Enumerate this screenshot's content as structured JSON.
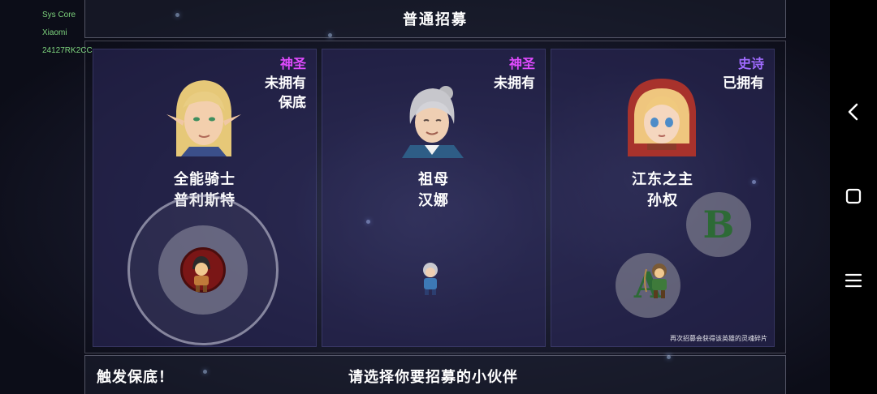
{
  "device_overlay": {
    "line1": "Sys Core",
    "line2": "Xiaomi",
    "line3": "24127RK2CC"
  },
  "header": {
    "title": "普通招募"
  },
  "cards": [
    {
      "rarity": "神圣",
      "owned_status": "未拥有",
      "pity_label": "保底",
      "hero_title": "全能骑士",
      "hero_name": "普利斯特",
      "portrait_icon": "elf-knight-portrait"
    },
    {
      "rarity": "神圣",
      "owned_status": "未拥有",
      "hero_title": "祖母",
      "hero_name": "汉娜",
      "portrait_icon": "grandmother-portrait"
    },
    {
      "rarity": "史诗",
      "owned_status": "已拥有",
      "hero_title": "江东之主",
      "hero_name": "孙权",
      "portrait_icon": "red-hood-girl-portrait",
      "note": "再次招募会获得该英雄的灵魂碎片"
    }
  ],
  "controls": {
    "b_label": "B",
    "a_label": "A"
  },
  "footer": {
    "trigger_text": "触发保底！",
    "prompt_text": "请选择你要招募的小伙伴"
  },
  "colors": {
    "divine": "#e14bff",
    "epic": "#a06bff",
    "debug_text": "#7dd37d"
  }
}
